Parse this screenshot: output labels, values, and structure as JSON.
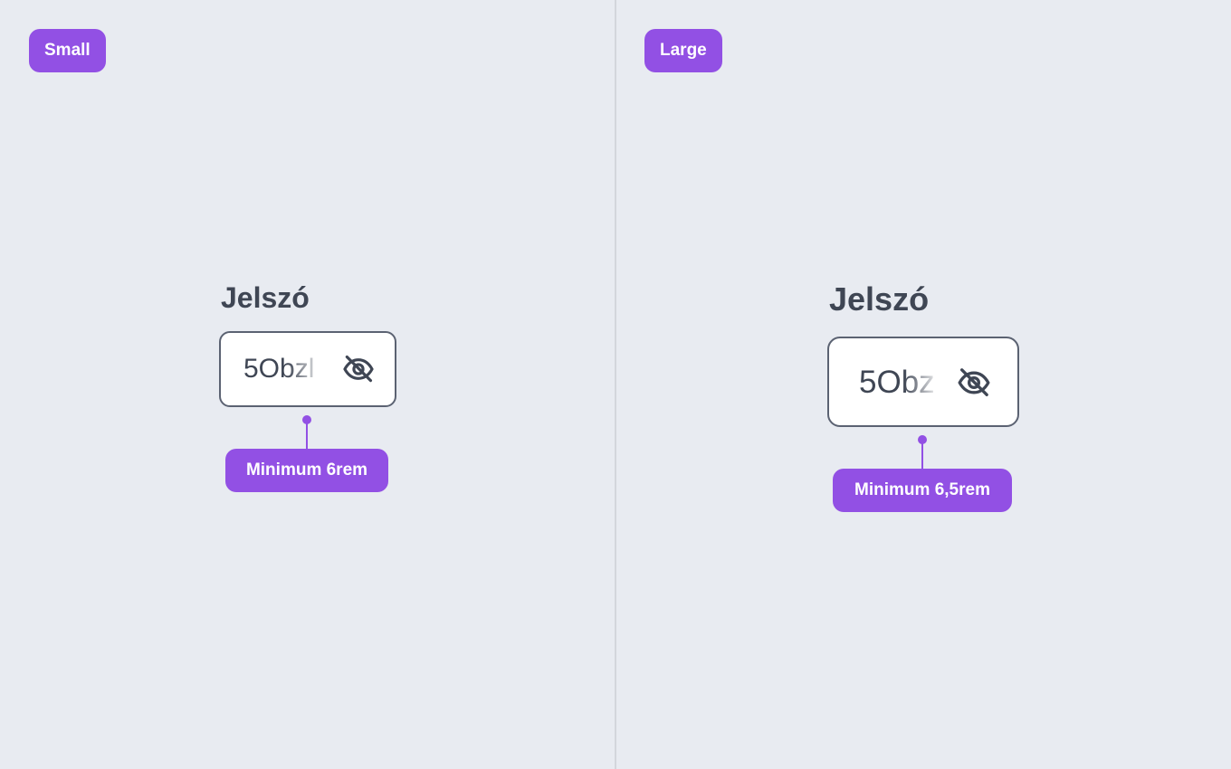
{
  "colors": {
    "background": "#e8ebf1",
    "accent": "#9250e4",
    "text": "#3f4654",
    "field_border": "#5b6272"
  },
  "small": {
    "size_badge": "Small",
    "label": "Jelszó",
    "value": "5Obzl",
    "toggle_icon": "eye-off-icon",
    "min_width_badge": "Minimum 6rem"
  },
  "large": {
    "size_badge": "Large",
    "label": "Jelszó",
    "value": "5Obz",
    "toggle_icon": "eye-off-icon",
    "min_width_badge": "Minimum 6,5rem"
  }
}
